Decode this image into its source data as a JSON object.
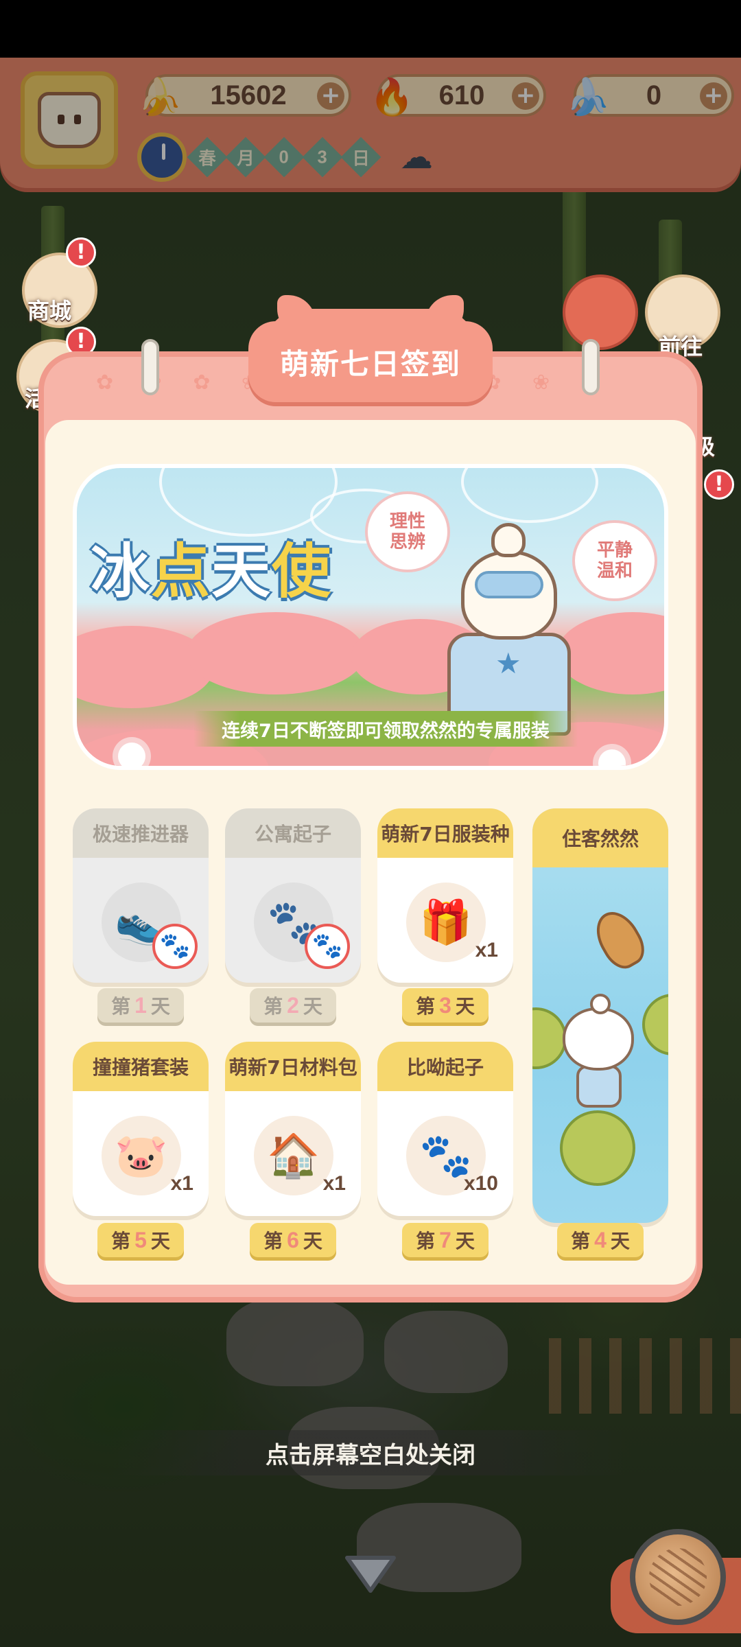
{
  "hud": {
    "currencies": [
      {
        "icon": "banana-icon",
        "value": "15602"
      },
      {
        "icon": "blue-flame-icon",
        "value": "610"
      },
      {
        "icon": "blue-banana-icon",
        "value": "0"
      }
    ],
    "date_cells": [
      "春",
      "月",
      "0",
      "3",
      "日"
    ],
    "weather_icon": "rain-cloud-icon"
  },
  "side_menu": {
    "shop_label": "商城",
    "goto_label": "前往",
    "partial_left": "活",
    "partial_right": "级"
  },
  "modal": {
    "title": "萌新七日签到",
    "banner": {
      "title_part1": "冰",
      "title_accent1": "点",
      "title_part2": "天",
      "title_accent2": "使",
      "trait_left": "理性\n思辨",
      "trait_right": "平静\n温和",
      "caption": "连续7日不断签即可领取然然的专属服装"
    },
    "rewards": [
      {
        "name": "极速推进器",
        "day_prefix": "第",
        "day": "1",
        "day_suffix": "天",
        "qty": "",
        "claimed": true,
        "icon": "boots-icon"
      },
      {
        "name": "公寓起子",
        "day_prefix": "第",
        "day": "2",
        "day_suffix": "天",
        "qty": "",
        "claimed": true,
        "icon": "paw-wand-icon"
      },
      {
        "name": "萌新7日服装种",
        "day_prefix": "第",
        "day": "3",
        "day_suffix": "天",
        "qty": "x1",
        "claimed": false,
        "icon": "mystery-chest-icon"
      },
      {
        "name": "住客然然",
        "day_prefix": "第",
        "day": "4",
        "day_suffix": "天",
        "qty": "",
        "claimed": false,
        "icon": "tenant-icon"
      },
      {
        "name": "撞撞猪套装",
        "day_prefix": "第",
        "day": "5",
        "day_suffix": "天",
        "qty": "x1",
        "claimed": false,
        "icon": "pig-costume-icon"
      },
      {
        "name": "萌新7日材料包",
        "day_prefix": "第",
        "day": "6",
        "day_suffix": "天",
        "qty": "x1",
        "claimed": false,
        "icon": "material-pack-icon"
      },
      {
        "name": "比呦起子",
        "day_prefix": "第",
        "day": "7",
        "day_suffix": "天",
        "qty": "x10",
        "claimed": false,
        "icon": "paw-wand-icon"
      }
    ]
  },
  "close_hint": "点击屏幕空白处关闭",
  "colors": {
    "modal_pink": "#f7b4a8",
    "card_yellow": "#f6d76e",
    "day_number": "#f08a7a",
    "hud_orange": "#f08a6e"
  }
}
